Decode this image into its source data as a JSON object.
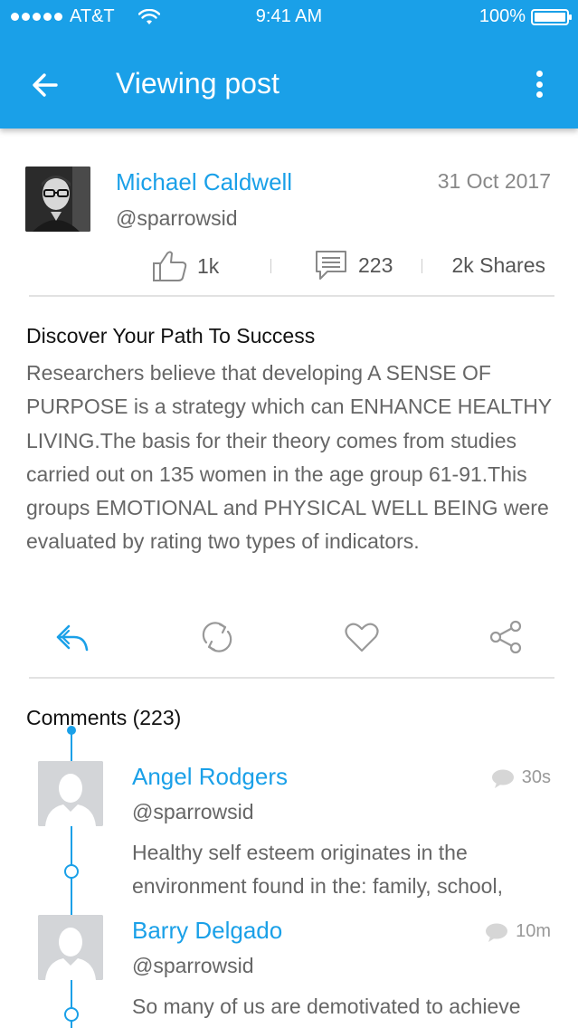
{
  "status_bar": {
    "carrier": "AT&T",
    "time": "9:41 AM",
    "battery": "100%"
  },
  "header": {
    "title": "Viewing post"
  },
  "post": {
    "author_name": "Michael Caldwell",
    "author_handle": "@sparrowsid",
    "date": "31 Oct 2017",
    "likes": "1k",
    "comments": "223",
    "shares": "2k Shares",
    "title": "Discover Your Path To Success",
    "body": "Researchers believe that developing A SENSE OF PURPOSE is a strategy which can ENHANCE HEALTHY LIVING.The basis for their theory comes from studies carried out on 135 women in the age group 61-91.This groups EMOTIONAL and PHYSICAL WELL BEING were evaluated by rating two types of indicators."
  },
  "comments_section": {
    "title": "Comments (223)",
    "items": [
      {
        "name": "Angel Rodgers",
        "handle": "@sparrowsid",
        "time": "30s",
        "text": "Healthy self esteem originates in the environment found in the: family, school,"
      },
      {
        "name": "Barry Delgado",
        "handle": "@sparrowsid",
        "time": "10m",
        "text": "So many of us are demotivated to achieve"
      }
    ]
  },
  "colors": {
    "accent": "#1aa0e8",
    "text_muted": "#666666",
    "divider": "#e2e2e2"
  },
  "icons": [
    "back-arrow-icon",
    "more-vertical-icon",
    "thumbs-up-icon",
    "comment-icon",
    "reply-icon",
    "repost-icon",
    "heart-icon",
    "share-icon",
    "comment-bubble-icon"
  ]
}
